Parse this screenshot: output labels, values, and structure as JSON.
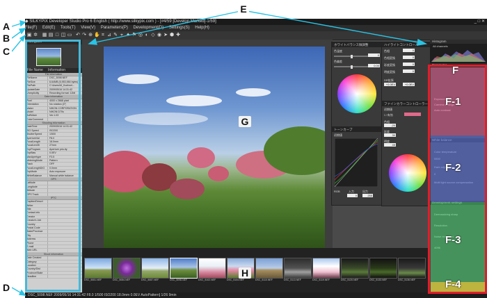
{
  "window": {
    "title": "SILKYPIX Developer Studio Pro 6 English ( http://www.silkypix.com ) - [#4/59 [Develop Marked]-1/59]"
  },
  "menu": [
    "File(F)",
    "Edit(E)",
    "Tools(T)",
    "View(V)",
    "Parameters(P)",
    "Development(D)",
    "Settings(S)",
    "Help(H)"
  ],
  "navigator": {
    "title": "Navigator"
  },
  "info_panel": {
    "header_name": "File Name",
    "header_info": "Information",
    "sections": [
      {
        "title": "File information",
        "rows": [
          [
            "FileName",
            "DSC_5098.NEF"
          ],
          [
            "FileSize",
            "6.64MB (6,953,984 bytes)"
          ],
          [
            "FilePath",
            "C:\\Users\\M_Koehne\\..."
          ],
          [
            "UpdateDate",
            "2009/05/16 14:31:42"
          ],
          [
            "Unexplicitly",
            "Recording format: 12bit"
          ]
        ]
      },
      {
        "title": "Data information",
        "rows": [
          [
            "Pixel",
            "4000 x 2668 pixel"
          ],
          [
            "Orientation",
            "No rotation (0°)"
          ],
          [
            "Maker",
            "NIKON CORPORATION"
          ],
          [
            "Model",
            "NIKON D70s"
          ],
          [
            "SoftWare",
            "Ver.1.03"
          ],
          [
            "ColorComment",
            ""
          ]
        ]
      },
      {
        "title": "Shooting information",
        "rows": [
          [
            "DateTime",
            "2009/05/16 14:31:42"
          ],
          [
            "ISO Speed",
            "ISO200"
          ],
          [
            "ShutterSpeed",
            "1/500"
          ],
          [
            "ApertureVal",
            "F8.0"
          ],
          [
            "FocalLength",
            "18.0mm"
          ],
          [
            "FocalLen35",
            "27mm"
          ],
          [
            "ExpProgram",
            "Aperture prio-ity"
          ],
          [
            "ExpBias",
            "0.0EV"
          ],
          [
            "MaxApertype",
            "F3.5"
          ],
          [
            "MeteringMode",
            "Pattern"
          ],
          [
            "Flash",
            "OFF"
          ],
          [
            "FocalLengthDIG",
            "0.0mm"
          ],
          [
            "ExpMode",
            "Auto exposure"
          ],
          [
            "WhiteBalance",
            "Manual white balance"
          ]
        ]
      },
      {
        "title": "GPS",
        "rows": [
          [
            "Latitude",
            ""
          ],
          [
            "Longitude",
            ""
          ],
          [
            "Altitude",
            ""
          ],
          [
            "GPS Track",
            ""
          ]
        ]
      },
      {
        "title": "IPTC",
        "rows": [
          [
            "Caption/Descri",
            ""
          ],
          [
            "Writer",
            ""
          ],
          [
            "Title",
            ""
          ],
          [
            "Contact info",
            ""
          ],
          [
            "Creator",
            ""
          ],
          [
            "Creator's Job",
            ""
          ],
          [
            "Country",
            ""
          ],
          [
            "Postal Code",
            ""
          ],
          [
            "State/Province",
            ""
          ],
          [
            "City",
            ""
          ],
          [
            "Address",
            ""
          ],
          [
            "Phone",
            ""
          ],
          [
            "E-mail",
            ""
          ],
          [
            "Web URL",
            ""
          ]
        ]
      },
      {
        "title": "Shoot information",
        "rows": [
          [
            "Date Created",
            ""
          ],
          [
            "Category",
            ""
          ],
          [
            "Location",
            ""
          ],
          [
            "Country/Dist",
            ""
          ],
          [
            "Province/State",
            ""
          ],
          [
            "Headline",
            ""
          ]
        ]
      }
    ]
  },
  "tool_windows": {
    "white_balance": {
      "title": "ホワイトバランス微調整",
      "label1": "色温度",
      "value1": "0",
      "label2": "色偏差",
      "value2": "0.00"
    },
    "highlight": {
      "title": "ハイライトコントロール",
      "labels": [
        "色相",
        "色相変換",
        "彩度変換",
        "明度変換"
      ],
      "values": [
        "0",
        "0",
        "0",
        "0"
      ],
      "dr_label": "DR拡張",
      "dr_value": "+0.0EV",
      "dr_value2": "+0.0EV"
    },
    "tone_curve": {
      "title": "トーンカーブ",
      "preset": "初期値",
      "channel": "RGB",
      "in_label": "入力",
      "out_label": "出力",
      "in_value": "0",
      "out_value": "255"
    },
    "fine_color": {
      "title": "ファインカラーコントローラー",
      "preset": "初期値",
      "checkbox_label": "有効",
      "values": [
        "-20",
        "30",
        "45"
      ],
      "labels": [
        "色相",
        "彩度",
        "明度"
      ]
    }
  },
  "histogram": {
    "title": "Histogram",
    "channel": "All channels"
  },
  "right_palette": {
    "sections": [
      {
        "title": "Parameter",
        "items": [
          "Exposure bias",
          "Camera settings",
          "Auto contrast"
        ]
      },
      {
        "title": "White balance",
        "items": [
          "Color temperature",
          "Dark adjustment",
          "Multi light source compensation"
        ]
      },
      {
        "title": "Development settings",
        "items": [
          "Demosaicing sharp",
          "Resolution",
          "Noise reduction"
        ]
      }
    ],
    "values": {
      "exposure": "0.00",
      "color_temp": "5500",
      "tint": "0",
      "dev": "4096"
    }
  },
  "filmstrip": {
    "thumbs": [
      {
        "caption": "DSC_5081.NEF"
      },
      {
        "caption": "DSC_5084.NEF"
      },
      {
        "caption": "DSC_5087.NEF"
      },
      {
        "caption": "DSC_5098.NEF"
      },
      {
        "caption": "DSC_5102.NEF"
      },
      {
        "caption": "DSC_5104.NEF"
      },
      {
        "caption": "DSC_5110.NEF"
      },
      {
        "caption": "DSC_5113.NEF"
      },
      {
        "caption": "DSC_5119.NEF"
      },
      {
        "caption": "DSC_5120.NEF"
      },
      {
        "caption": "DSC_5133.NEF"
      },
      {
        "caption": "DSC_5136.NEF"
      }
    ]
  },
  "statusbar": {
    "text": "DSC_5098.NEF 2009/05/16 14:31:42 F8.0 1/500 ISO200 18.0mm 0.0EV AutoPattern] 1/26 9min"
  },
  "annotations": {
    "A": "A",
    "B": "B",
    "C": "C",
    "D": "D",
    "E": "E",
    "F": "F",
    "F1": "F-1",
    "F2": "F-2",
    "F3": "F-3",
    "F4": "F-4",
    "G": "G",
    "H": "H"
  },
  "colors": {
    "callout_line": "#29c4e6",
    "left_highlight": "#46b8d8",
    "f_border": "#e21d2b",
    "f1": "#e65a8e",
    "f2": "#5a6fd8",
    "f3": "#46d06e"
  }
}
